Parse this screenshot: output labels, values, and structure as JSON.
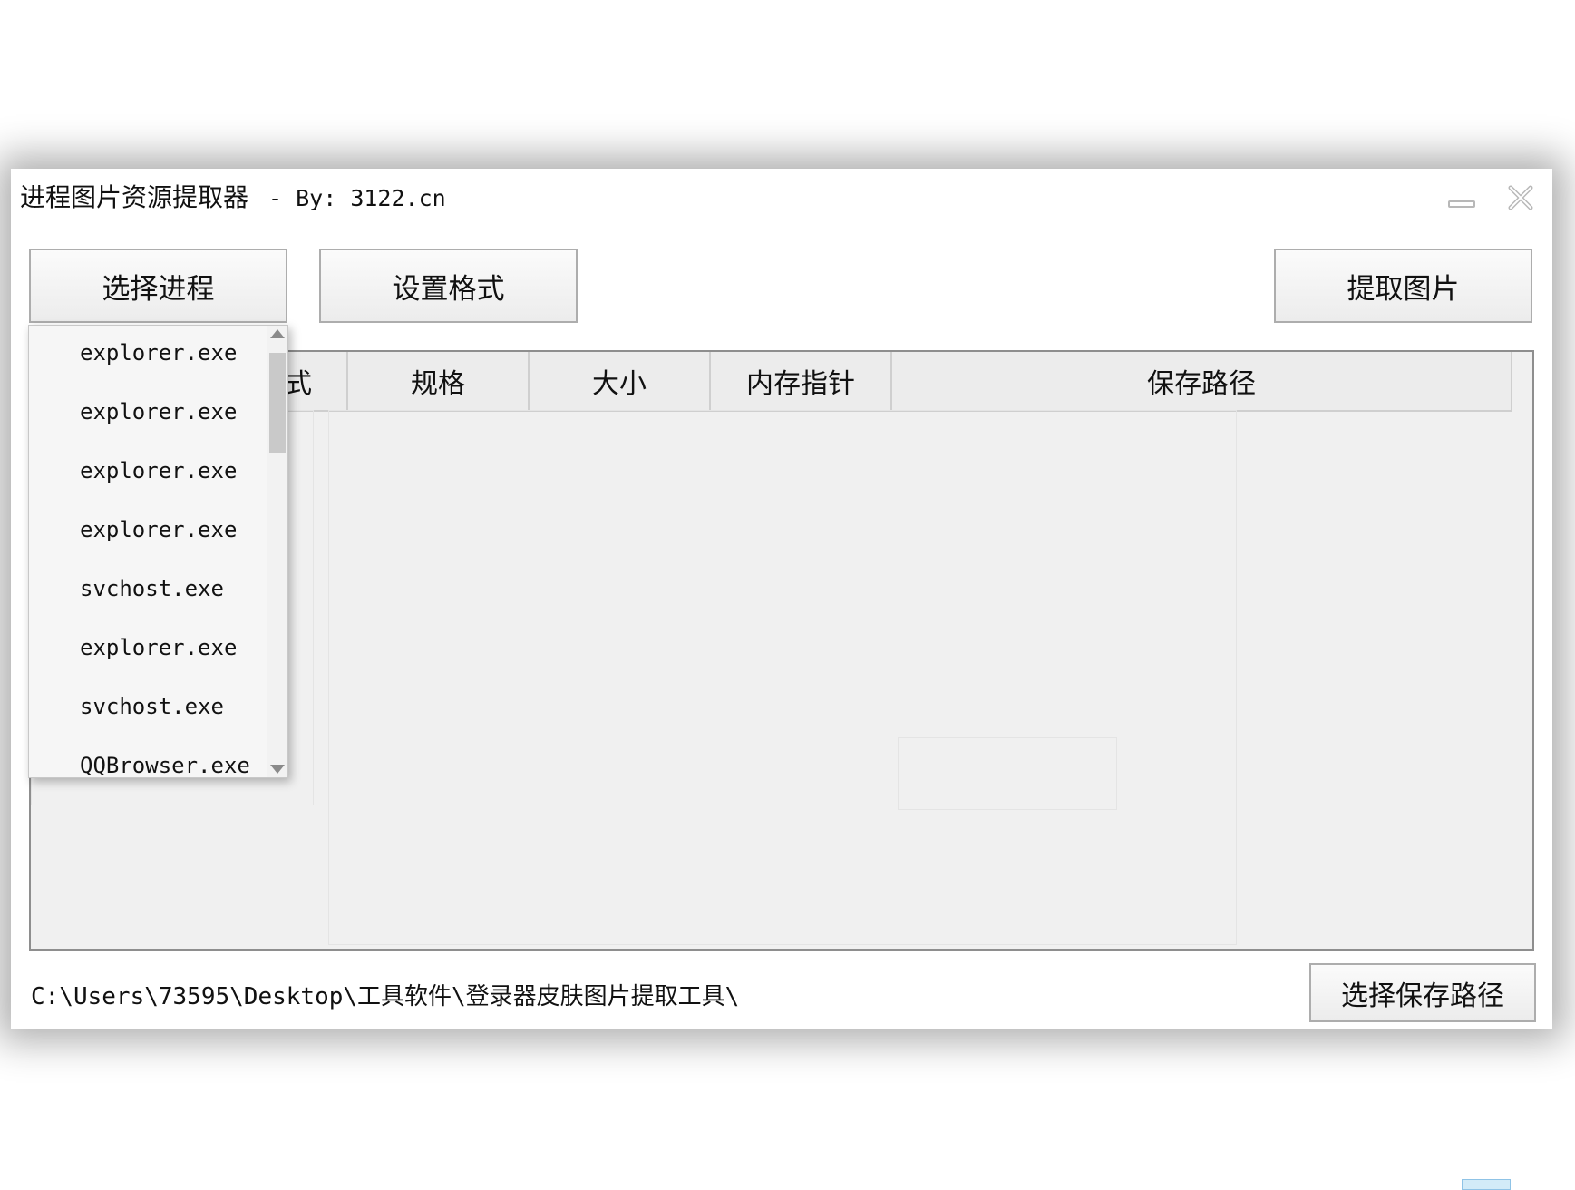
{
  "window": {
    "title": "进程图片资源提取器",
    "title_sep": "- By: 3122.cn"
  },
  "toolbar": {
    "select_process": "选择进程",
    "set_format": "设置格式",
    "extract_images": "提取图片"
  },
  "table": {
    "columns": [
      "式",
      "规格",
      "大小",
      "内存指针",
      "保存路径"
    ]
  },
  "process_dropdown": {
    "items": [
      "explorer.exe",
      "explorer.exe",
      "explorer.exe",
      "explorer.exe",
      "svchost.exe",
      "explorer.exe",
      "svchost.exe",
      "QQBrowser.exe"
    ]
  },
  "footer": {
    "save_path": "C:\\Users\\73595\\Desktop\\工具软件\\登录器皮肤图片提取工具\\",
    "choose_path": "选择保存路径"
  },
  "icons": {
    "minimize": "minimize-icon",
    "close": "close-icon"
  }
}
